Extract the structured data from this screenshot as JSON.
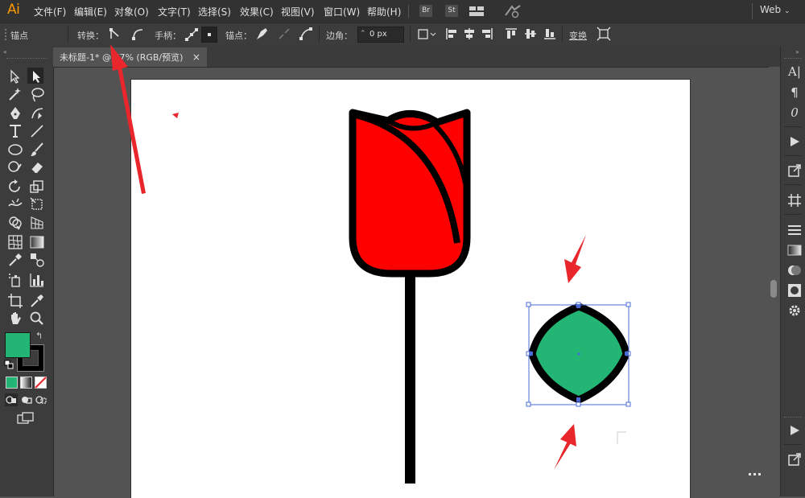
{
  "app": {
    "logo": "Ai"
  },
  "menu": {
    "items": [
      "文件(F)",
      "编辑(E)",
      "对象(O)",
      "文字(T)",
      "选择(S)",
      "效果(C)",
      "视图(V)",
      "窗口(W)",
      "帮助(H)"
    ],
    "bridge": "Br",
    "stock": "St",
    "workspace": "Web"
  },
  "control_bar": {
    "anchor_label": "锚点",
    "convert_label": "转换：",
    "handle_label": "手柄：",
    "anchor_points_label": "锚点：",
    "corner_label": "边角：",
    "corner_value": "0 px",
    "transform_label": "变换"
  },
  "document": {
    "tab_title": "未标题-1* @ 67% (RGB/预览)",
    "close_glyph": "×"
  },
  "colors": {
    "fill": "#22b573",
    "stroke": "#000000",
    "rose": "#ff0000",
    "leaf": "#22b573",
    "annotation": "#e8262b",
    "selection": "#4a6bd8"
  }
}
